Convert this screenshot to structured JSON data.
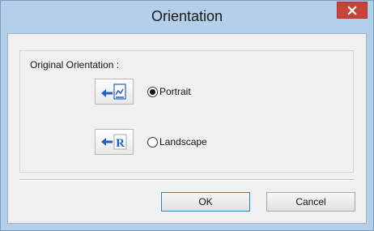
{
  "dialog": {
    "title": "Orientation",
    "close_icon": "close-icon"
  },
  "group": {
    "label": "Original Orientation :"
  },
  "options": {
    "portrait": {
      "label": "Portrait",
      "checked": true,
      "icon": "portrait-orientation-icon"
    },
    "landscape": {
      "label": "Landscape",
      "checked": false,
      "icon": "landscape-orientation-icon"
    }
  },
  "buttons": {
    "ok": "OK",
    "cancel": "Cancel"
  },
  "colors": {
    "frame": "#b3cfe9",
    "close": "#c6443b",
    "client": "#f0f0f0",
    "icon_blue": "#1f5fbf"
  }
}
